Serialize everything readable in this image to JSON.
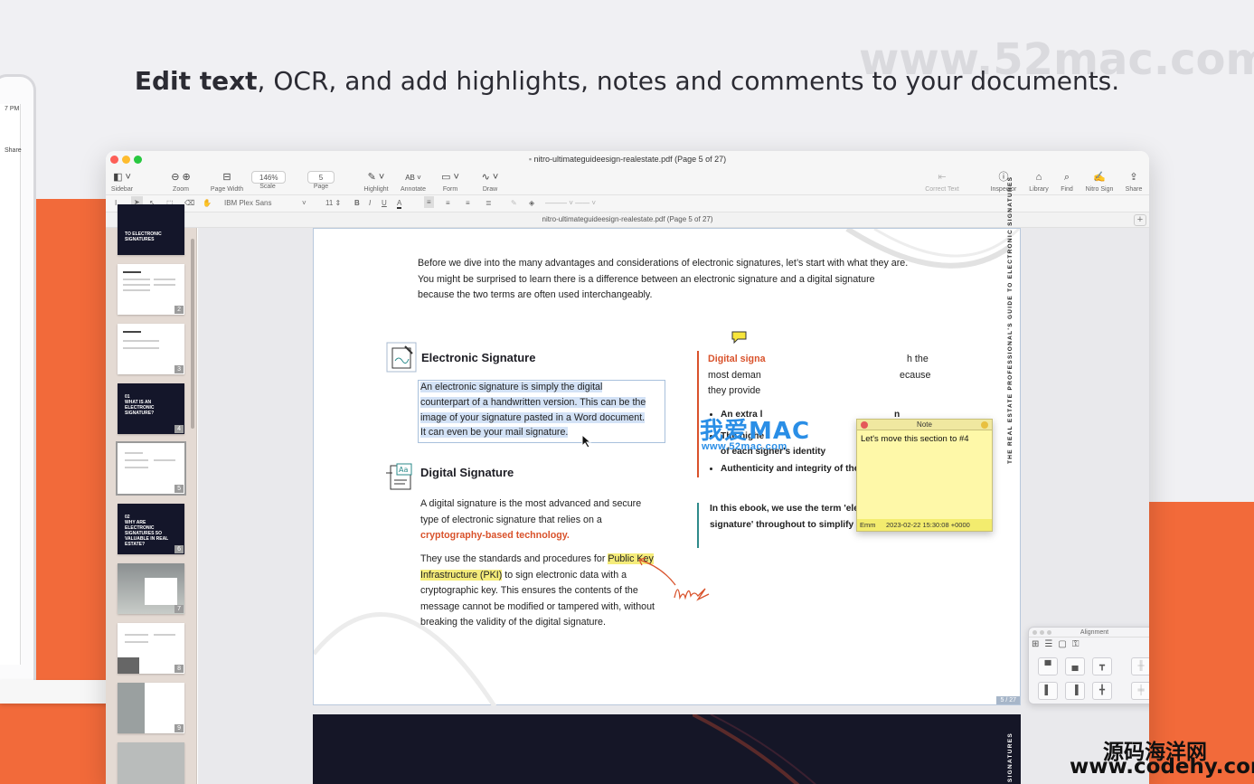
{
  "headline": {
    "bold": "Edit text",
    "rest": ", OCR, and add highlights, notes and comments to your documents."
  },
  "watermarks": {
    "top": "www.52mac.com",
    "bottom_cn": "源码海洋网",
    "bottom_url": "www.codehy.com",
    "center_cn": "我爱MAC",
    "center_url": "www.52mac.com"
  },
  "laptop": {
    "time": "7 PM",
    "share": "Share"
  },
  "window": {
    "title": "nitro-ultimateguideesign-realestate.pdf (Page 5 of 27)",
    "tab_title": "nitro-ultimateguideesign-realestate.pdf (Page 5 of 27)",
    "colors": {
      "close": "#fd5f57",
      "minimize": "#febc2e",
      "zoom": "#28c840",
      "accent": "#d9522b",
      "highlight": "#f5ec7a",
      "brand_orange": "#f26a3a"
    }
  },
  "toolbar": {
    "sidebar": "Sidebar",
    "zoom": "Zoom",
    "page_width": "Page Width",
    "scale": "Scale",
    "scale_value": "146%",
    "page": "Page",
    "page_value": "5",
    "highlight": "Highlight",
    "annotate": "Annotate",
    "annotate_icon": "AB",
    "form": "Form",
    "draw": "Draw",
    "correct_text": "Correct Text",
    "inspector": "Inspector",
    "library": "Library",
    "find": "Find",
    "nitro_sign": "Nitro Sign",
    "share": "Share"
  },
  "formatbar": {
    "font": "IBM Plex Sans",
    "size": "11",
    "bold": "B",
    "italic": "I",
    "underline": "U",
    "color": "A"
  },
  "sidebar": {
    "pages": [
      {
        "n": "2"
      },
      {
        "n": "3"
      },
      {
        "n": "4",
        "title": "01\nWHAT IS AN ELECTRONIC SIGNATURE?"
      },
      {
        "n": "5"
      },
      {
        "n": "6",
        "title": "02\nWHY ARE ELECTRONIC SIGNATURES SO VALUABLE IN REAL ESTATE?"
      },
      {
        "n": "7"
      },
      {
        "n": "8"
      },
      {
        "n": "9"
      }
    ],
    "top_partial": "TO ELECTRONIC SIGNATURES"
  },
  "document": {
    "intro": "Before we dive into the many advantages and considerations of electronic signatures, let’s start with what they are. You might be surprised to learn there is a difference between an electronic signature and a digital signature because the two terms are often used interchangeably.",
    "esig_heading": "Electronic Signature",
    "esig_lines": [
      "An electronic signature is simply the digital",
      "counterpart of a handwritten version. This can be the",
      "image of your signature pasted in a Word document.",
      "It can even be your mail signature."
    ],
    "dsig_heading": "Digital Signature",
    "dsig_p1_a": "A digital signature is the most advanced and secure type of electronic signature that relies on a ",
    "dsig_p1_b": "cryptography-based technology.",
    "dsig_p2_a": "They use the standards and procedures for ",
    "dsig_p2_hl": "Public Key Infrastructure (PKI)",
    "dsig_p2_b": " to sign electronic data with a cryptographic key. This ensures the contents of the message cannot be modified or tampered with, without breaking the validity of the digital signature.",
    "right_intro_orange": "Digital signa",
    "right_intro_rest1": "h the",
    "right_intro_line2": "most deman",
    "right_intro_rest2": "ecause",
    "right_intro_line3": "they provide",
    "bullets": [
      "An extra l",
      "The highe",
      "of each signer's identity",
      "Authenticity and integrity of the document"
    ],
    "bullet_tail": "n",
    "callout": "In this ebook, we use the term 'electronic signature' throughout to simplify terminology.",
    "vertical_text": "THE REAL ESTATE PROFESSIONAL'S GUIDE TO ELECTRONIC SIGNATURES",
    "vertical_text2": "SIGNATURES",
    "page_number": "5 / 27",
    "handwriting": "link"
  },
  "note": {
    "title": "Note",
    "text": "Let's move this section to #4",
    "author": "Emm",
    "timestamp": "2023-02-22 15:30:08 +0000"
  },
  "alignment_panel": {
    "title": "Alignment"
  }
}
